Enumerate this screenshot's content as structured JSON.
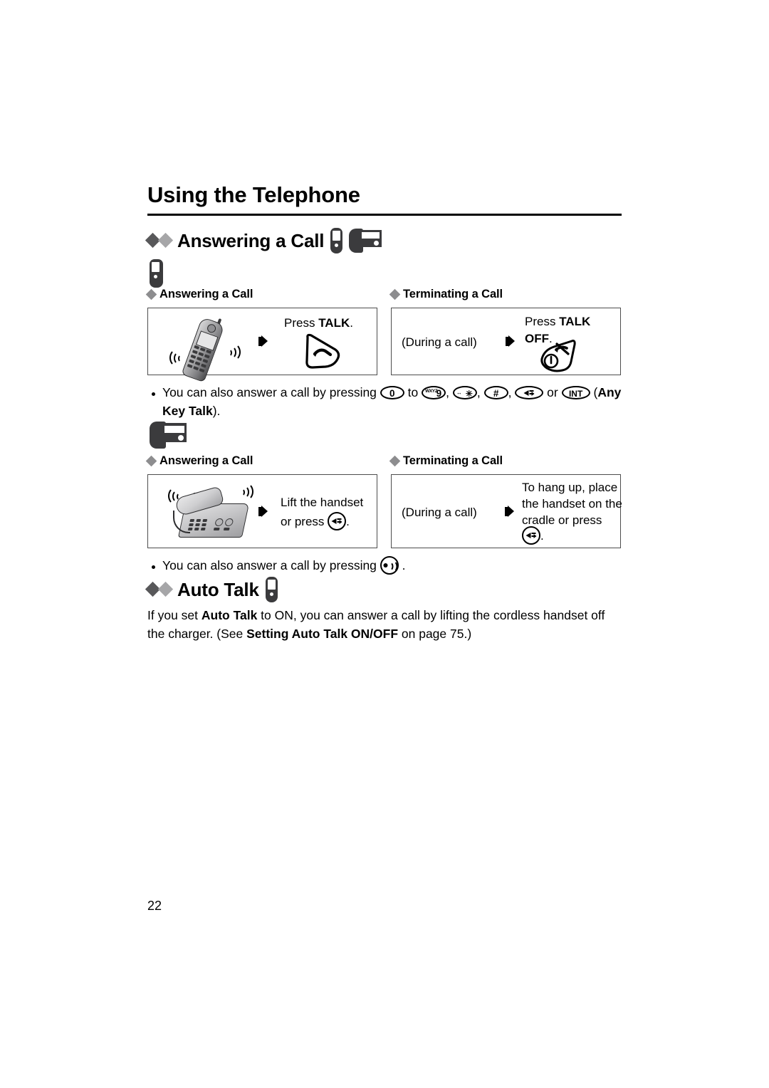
{
  "page": {
    "chapter_title": "Using the Telephone",
    "page_number": "22"
  },
  "sections": [
    {
      "id": "answering-a-call",
      "heading": "Answering a Call",
      "heading_icons": [
        "handset-icon",
        "base-unit-icon"
      ],
      "blocks": [
        {
          "device_icon": "handset-icon",
          "columns": [
            {
              "sub_heading": "Answering a Call",
              "illustration": "cordless-handset-ringing",
              "step_text_lines": [
                "Press TALK."
              ],
              "step_text_plain": "Press ",
              "step_text_bold": "TALK",
              "step_text_tail": ".",
              "button_icon": "talk-button-icon"
            },
            {
              "sub_heading": "Terminating a Call",
              "left_label": "(During a call)",
              "step_text_plain": "Press ",
              "step_text_bold": "TALK",
              "step_text_bold2": "OFF",
              "step_text_tail": ".",
              "button_icon": "talk-off-button-icon"
            }
          ],
          "note": {
            "prefix": "You can also answer a call by pressing ",
            "keys": [
              {
                "name": "key-0",
                "label": "0"
              },
              {
                "name": "key-9",
                "label": "9",
                "mini": "WXYZ"
              },
              {
                "name": "key-star",
                "label": "✳",
                "mini": "↔"
              },
              {
                "name": "key-hash",
                "label": "#"
              },
              {
                "name": "key-speakerphone",
                "label": "speaker-icon"
              },
              {
                "name": "key-int",
                "label": "INT"
              }
            ],
            "joiner_to": " to ",
            "joiner_comma": ", ",
            "joiner_or": " or ",
            "suffix_open": " (",
            "suffix_bold": "Any Key Talk",
            "suffix_close": ")."
          }
        },
        {
          "device_icon": "base-unit-icon",
          "columns": [
            {
              "sub_heading": "Answering a Call",
              "illustration": "corded-desk-phone-ringing",
              "line1": "Lift the handset",
              "line2_prefix": "or press ",
              "line2_key": "speakerphone-key-icon",
              "line2_suffix": "."
            },
            {
              "sub_heading": "Terminating a Call",
              "left_label": "(During a call)",
              "line1": "To hang up, place",
              "line2": "the handset on the",
              "line3": "cradle or press",
              "line4_key": "speakerphone-key-icon",
              "line4_suffix": "."
            }
          ],
          "note": {
            "prefix": "You can also answer a call by pressing ",
            "key": "sp-phone-key-icon",
            "suffix": " ."
          }
        }
      ]
    },
    {
      "id": "auto-talk",
      "heading": "Auto Talk",
      "heading_icons": [
        "handset-icon"
      ],
      "paragraph": {
        "p1": "If you set ",
        "b1": "Auto Talk",
        "p2": " to ON, you can answer a call by lifting the cordless handset off the charger. (See ",
        "b2": "Setting Auto Talk ON/OFF",
        "p3": " on page 75.)"
      }
    }
  ],
  "colors": {
    "diamond_dark": "#58585a",
    "diamond_light": "#a6a6a8",
    "diamond_sub": "#8d8d8f",
    "rule": "#000000",
    "box_border": "#4d4d4d",
    "device_icon": "#3b3b3d"
  }
}
